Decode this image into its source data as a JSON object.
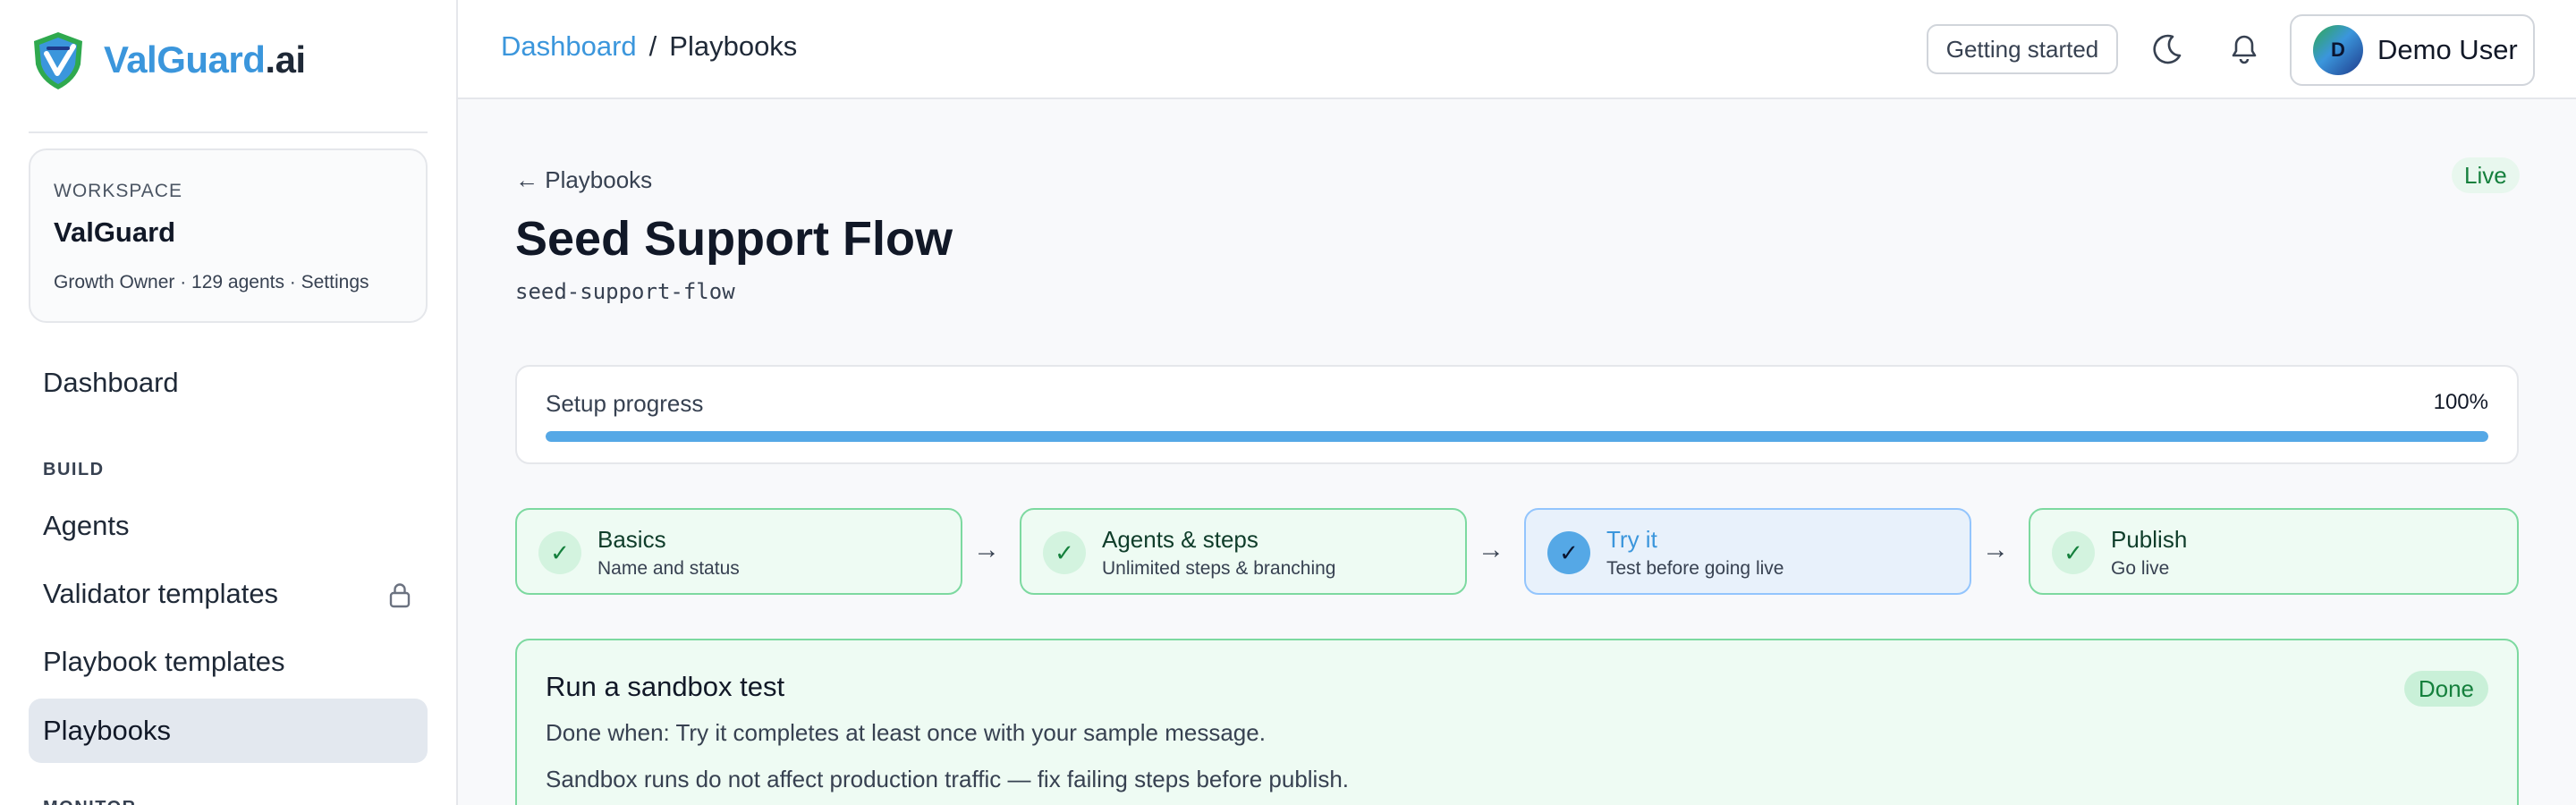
{
  "brand": {
    "part1": "ValGuard",
    "part2": ".ai"
  },
  "workspace": {
    "label": "WORKSPACE",
    "name": "ValGuard",
    "meta": "Growth Owner · 129 agents · Settings"
  },
  "sidebar": {
    "dashboard": "Dashboard",
    "build_section": "BUILD",
    "items": [
      {
        "label": "Agents"
      },
      {
        "label": "Validator templates",
        "locked": true
      },
      {
        "label": "Playbook templates"
      },
      {
        "label": "Playbooks",
        "active": true
      }
    ],
    "next_section": "MONITOR"
  },
  "topbar": {
    "breadcrumb": {
      "root": "Dashboard",
      "sep": "/",
      "current": "Playbooks"
    },
    "getting_started": "Getting started",
    "theme_icon": "moon-icon",
    "notifications_icon": "bell-icon",
    "user": {
      "initial": "D",
      "name": "Demo User"
    }
  },
  "main": {
    "back_link": "← Playbooks",
    "status": "Live",
    "title": "Seed Support Flow",
    "slug": "seed-support-flow",
    "progress": {
      "label": "Setup progress",
      "value": "100%",
      "fraction": 1.0
    },
    "steps": [
      {
        "title": "Basics",
        "subtitle": "Name and status",
        "check": "✓"
      },
      {
        "title": "Agents & steps",
        "subtitle": "Unlimited steps & branching",
        "check": "✓"
      },
      {
        "title": "Try it",
        "subtitle": "Test before going live",
        "check": "✓"
      },
      {
        "title": "Publish",
        "subtitle": "Go live",
        "check": "✓"
      }
    ],
    "arrow": "→",
    "task": {
      "title": "Run a sandbox test",
      "status": "Done",
      "line1": "Done when: Try it completes at least once with your sample message.",
      "line2": "Sandbox runs do not affect production traffic — fix failing steps before publish."
    }
  },
  "colors": {
    "accent_blue": "#3b96dc",
    "accent_green": "#2fa94e",
    "success_bg": "#eefbf3",
    "success_border": "#7dd9a0",
    "progress_fill": "#55a8e6"
  }
}
